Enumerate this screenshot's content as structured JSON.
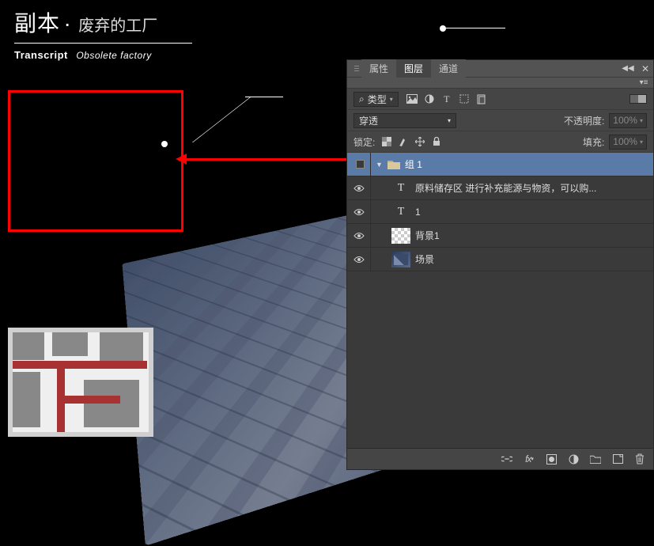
{
  "title": {
    "main": "副本",
    "separator": "·",
    "sub": "废弃的工厂",
    "en_main": "Transcript",
    "en_sub": "Obsolete factory"
  },
  "panel": {
    "tabs": {
      "properties": "属性",
      "layers": "图层",
      "channels": "通道"
    },
    "filter": {
      "label": "类型"
    },
    "blend_mode": {
      "value": "穿透"
    },
    "opacity": {
      "label": "不透明度:",
      "value": "100%"
    },
    "lock": {
      "label": "锁定:"
    },
    "fill": {
      "label": "填充:",
      "value": "100%"
    },
    "layers": [
      {
        "type": "group",
        "name": "组 1",
        "selected": true,
        "visible": false
      },
      {
        "type": "text",
        "name": "原料储存区  进行补充能源与物资，可以购...",
        "visible": true
      },
      {
        "type": "text",
        "name": "1",
        "visible": true
      },
      {
        "type": "raster",
        "name": "背景1",
        "visible": true,
        "thumb": "checker"
      },
      {
        "type": "raster",
        "name": "场景",
        "visible": true,
        "thumb": "scene"
      }
    ],
    "footer_icons": [
      "link",
      "fx",
      "mask",
      "adjust",
      "group",
      "new",
      "trash"
    ]
  }
}
